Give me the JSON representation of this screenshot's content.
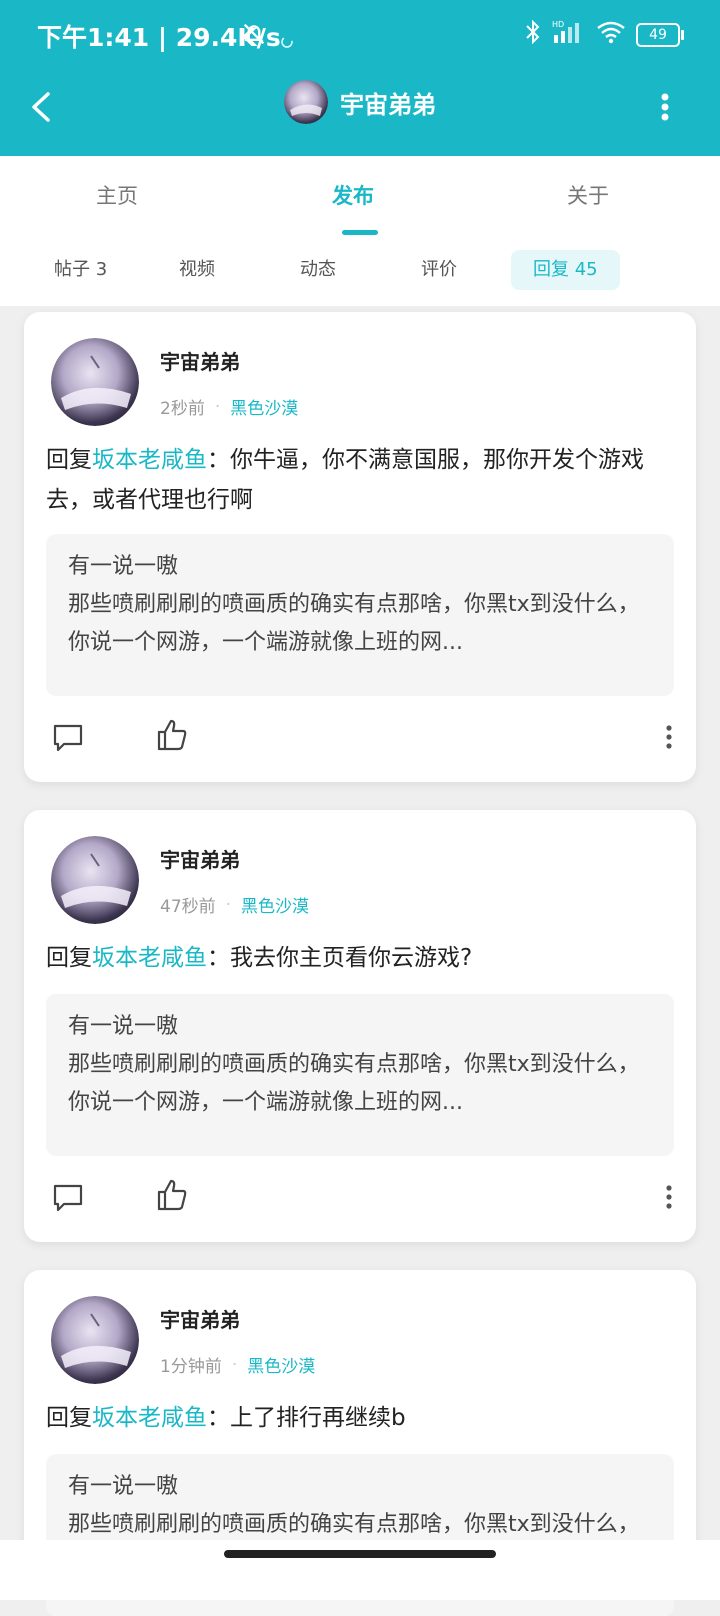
{
  "status_bar": {
    "time": "下午1:41 | 29.4K/s",
    "battery": "49"
  },
  "nav": {
    "title": "宇宙弟弟"
  },
  "tabs": [
    {
      "label": "主页"
    },
    {
      "label": "发布"
    },
    {
      "label": "关于"
    }
  ],
  "subtabs": [
    {
      "label": "帖子 3"
    },
    {
      "label": "视频"
    },
    {
      "label": "动态"
    },
    {
      "label": "评价"
    },
    {
      "label": "回复 45"
    }
  ],
  "posts": [
    {
      "author": "宇宙弟弟",
      "time": "2秒前",
      "game": "黑色沙漠",
      "reply_prefix": "回复",
      "reply_target": "坂本老咸鱼",
      "reply_text": "：你牛逼，你不满意国服，那你开发个游戏去，或者代理也行啊",
      "quote_author": "有一说一嗷",
      "quote_text": "那些喷刷刷刷的喷画质的确实有点那啥，你黑tx到没什么，你说一个网游，一个端游就像上班的网..."
    },
    {
      "author": "宇宙弟弟",
      "time": "47秒前",
      "game": "黑色沙漠",
      "reply_prefix": "回复",
      "reply_target": "坂本老咸鱼",
      "reply_text": "：我去你主页看你云游戏?",
      "quote_author": "有一说一嗷",
      "quote_text": "那些喷刷刷刷的喷画质的确实有点那啥，你黑tx到没什么，你说一个网游，一个端游就像上班的网..."
    },
    {
      "author": "宇宙弟弟",
      "time": "1分钟前",
      "game": "黑色沙漠",
      "reply_prefix": "回复",
      "reply_target": "坂本老咸鱼",
      "reply_text": "：上了排行再继续b",
      "quote_author": "有一说一嗷",
      "quote_text": "那些喷刷刷刷的喷画质的确实有点那啥，你黑tx到没什么，你说一个网游，一个端游就像上班的网..."
    }
  ],
  "colors": {
    "accent": "#1ab8c7",
    "background": "#efefef"
  }
}
